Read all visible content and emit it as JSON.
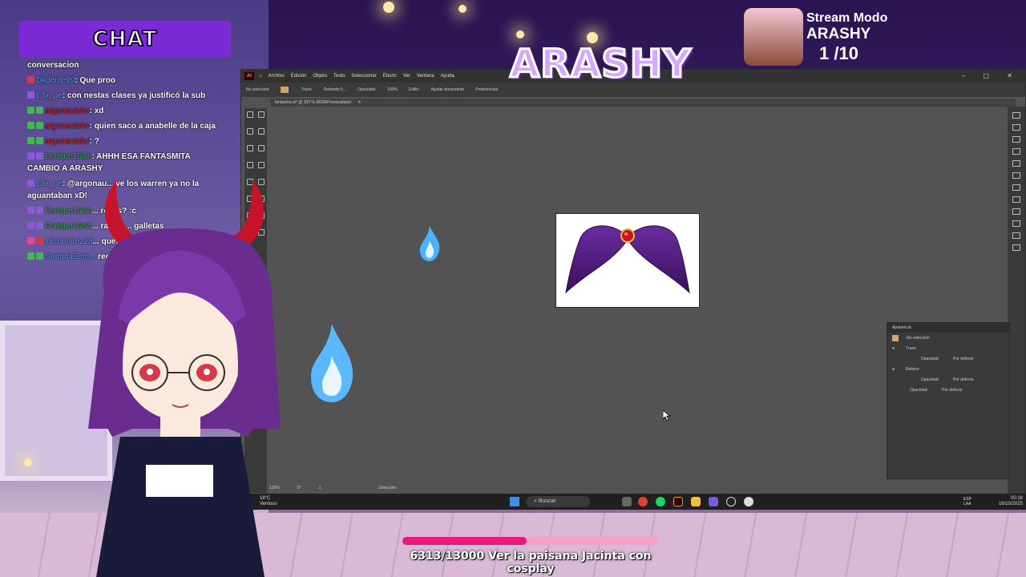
{
  "chat": {
    "title": "CHAT",
    "messages": [
      {
        "user": "",
        "text": "conversacion"
      },
      {
        "user": "Dkdente99",
        "text": ": Que proo"
      },
      {
        "user": "L3x_pe",
        "text": ": con nestas clases ya justificó la sub"
      },
      {
        "user": "argonautalvr",
        "text": ": xd"
      },
      {
        "user": "argonautalvr",
        "text": ": quien saco a anabelle de la caja"
      },
      {
        "user": "argonautalvr",
        "text": ": ?"
      },
      {
        "user": "Enrique16ish",
        "text": ": AHHH ESA FANTASMITA CAMBIO A ARASHY"
      },
      {
        "user": "L3x_pe",
        "text": ": @argonau... ve los warren ya no la aguantaban xD!"
      },
      {
        "user": "Enrique16ish",
        "text": "... rocas? :c"
      },
      {
        "user": "Enrique16ish",
        "text": "... rastar ... galletas"
      },
      {
        "user": "luisramirez28",
        "text": "... queda"
      },
      {
        "user": "StreamElem...",
        "text": " redeemed Audio..."
      }
    ],
    "colors": {
      "blue": "#5aa8ff",
      "red": "#d42a2a",
      "green": "#3cbd4a",
      "white": "#ffffff"
    }
  },
  "stream": {
    "logo": "ARASHY",
    "mode_label": "Stream Modo",
    "mode_name": "ARASHY",
    "mode_counter": "1  /10"
  },
  "illustrator": {
    "app_icon": "Ai",
    "menu": [
      "Archivo",
      "Edición",
      "Objeto",
      "Texto",
      "Seleccionar",
      "Efecto",
      "Ver",
      "Ventana",
      "Ayuda"
    ],
    "control_bar": {
      "selection": "No selección",
      "stroke_label": "Trazo:",
      "brush": "Redondo 5...",
      "opacity_label": "Opacidad:",
      "opacity_value": "100%",
      "style_label": "Estilo:",
      "doc_button": "Ajustar documento",
      "prefs_button": "Preferencias"
    },
    "document_tab": "fantasma.ai* @ 100 % (RGB/Previsualizar)",
    "status": {
      "zoom": "100%",
      "rotation": "0°",
      "artboard": "1",
      "mode": "Selección"
    },
    "panel": {
      "title": "Apariencia",
      "header": "No selección",
      "rows": [
        {
          "label": "Trazo",
          "value": ""
        },
        {
          "label": "Opacidad:",
          "value": "Por defecto"
        },
        {
          "label": "Relleno",
          "value": ""
        },
        {
          "label": "Opacidad:",
          "value": "Por defecto"
        },
        {
          "label": "Opacidad:",
          "value": "Por defecto"
        }
      ]
    }
  },
  "taskbar": {
    "weather_temp": "18°C",
    "weather_desc": "Ventoso",
    "search_label": "Buscar",
    "lang": "ESP",
    "lang_sub": "LAA",
    "time": "00:18",
    "date": "16/10/2025"
  },
  "goal": {
    "text": "6313/13000 Ver la paisana Jacinta con cosplay",
    "current": 6313,
    "target": 13000
  }
}
